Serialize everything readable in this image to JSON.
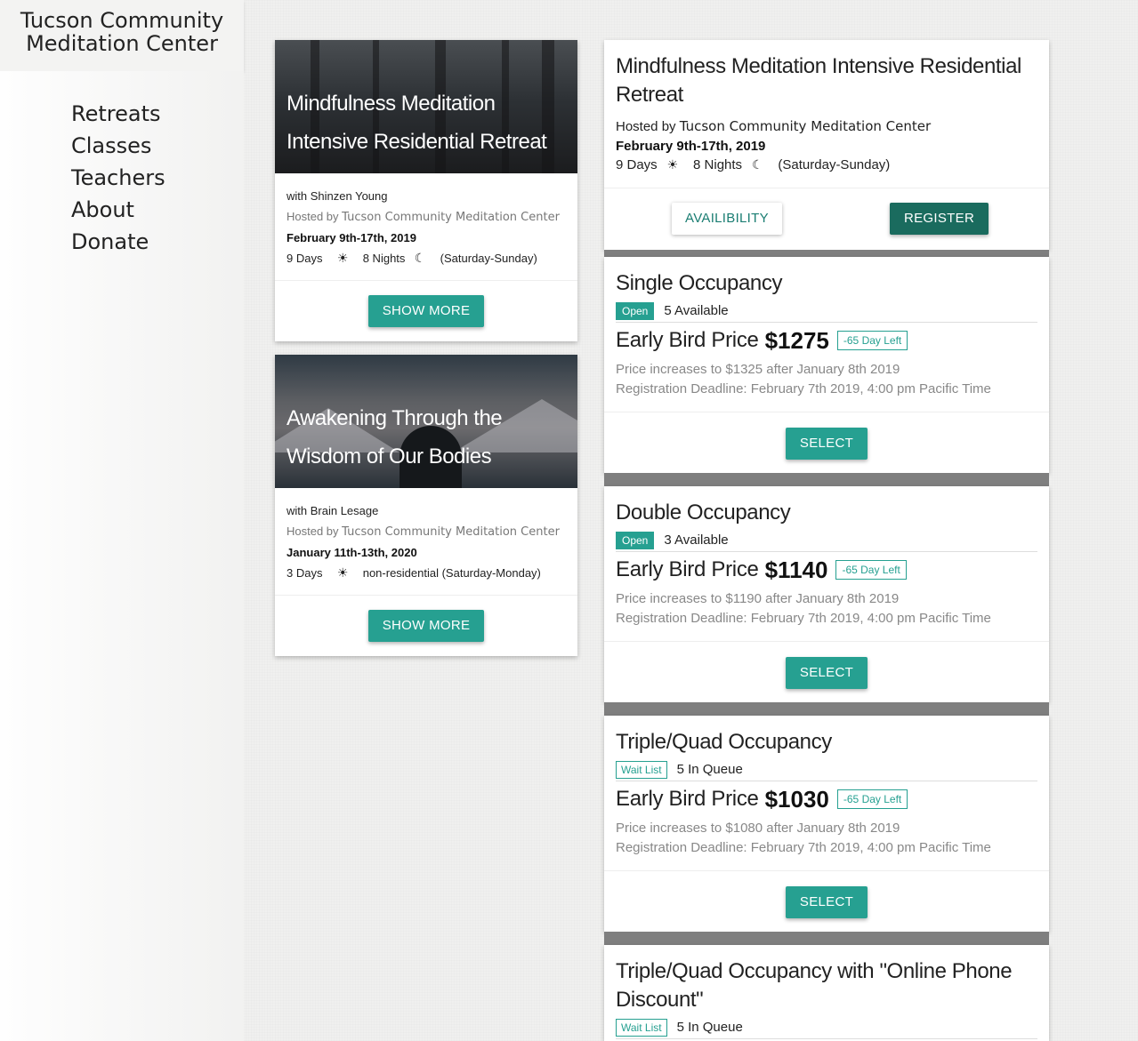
{
  "brand": {
    "line1": "Tucson Community",
    "line2": "Meditation Center"
  },
  "nav": [
    "Retreats",
    "Classes",
    "Teachers",
    "About",
    "Donate"
  ],
  "cards": [
    {
      "title_line1": "Mindfulness Meditation",
      "title_line2": "Intensive Residential Retreat",
      "teacher": "with Shinzen Young",
      "hosted_prefix": "Hosted by",
      "host": "Tucson Community Meditation Center",
      "dates": "February 9th-17th, 2019",
      "days": "9 Days",
      "nights": "8 Nights",
      "range": "(Saturday-Sunday)",
      "button": "SHOW MORE"
    },
    {
      "title_line1": "Awakening Through the",
      "title_line2": "Wisdom of Our Bodies",
      "teacher": "with Brain Lesage",
      "hosted_prefix": "Hosted by",
      "host": "Tucson Community Meditation Center",
      "dates": "January 11th-13th, 2020",
      "days": "3 Days",
      "range": "non-residential (Saturday-Monday)",
      "button": "SHOW MORE"
    }
  ],
  "detail": {
    "title": "Mindfulness Meditation Intensive Residential Retreat",
    "hosted_prefix": "Hosted by",
    "host": "Tucson Community Meditation Center",
    "dates": "February 9th-17th, 2019",
    "days": "9 Days",
    "nights": "8 Nights",
    "range": "(Saturday-Sunday)",
    "availability_button": "AVAILIBILITY",
    "register_button": "REGISTER"
  },
  "options": [
    {
      "title": "Single Occupancy",
      "status": "Open",
      "avail": "5 Available",
      "price_label": "Early Bird Price",
      "price": "$1275",
      "days_left": "-65 Day Left",
      "increase": "Price increases to $1325 after January 8th 2019",
      "deadline": "Registration Deadline: February 7th 2019, 4:00 pm Pacific Time",
      "button": "SELECT"
    },
    {
      "title": "Double Occupancy",
      "status": "Open",
      "avail": "3 Available",
      "price_label": "Early Bird Price",
      "price": "$1140",
      "days_left": "-65 Day Left",
      "increase": "Price increases to $1190 after January 8th 2019",
      "deadline": "Registration Deadline: February 7th 2019, 4:00 pm Pacific Time",
      "button": "SELECT"
    },
    {
      "title": "Triple/Quad Occupancy",
      "status": "Wait List",
      "avail": "5 In Queue",
      "price_label": "Early Bird Price",
      "price": "$1030",
      "days_left": "-65 Day Left",
      "increase": "Price increases to $1080 after January 8th 2019",
      "deadline": "Registration Deadline: February 7th 2019, 4:00 pm Pacific Time",
      "button": "SELECT"
    },
    {
      "title": "Triple/Quad Occupancy with \"Online Phone Discount\"",
      "status": "Wait List",
      "avail": "5 In Queue"
    }
  ],
  "icons": {
    "sun": "sun-icon",
    "moon": "moon-icon"
  },
  "colors": {
    "accent": "#26a091",
    "accent_dark": "#1a6b5e",
    "divider": "#7f7f7f"
  }
}
